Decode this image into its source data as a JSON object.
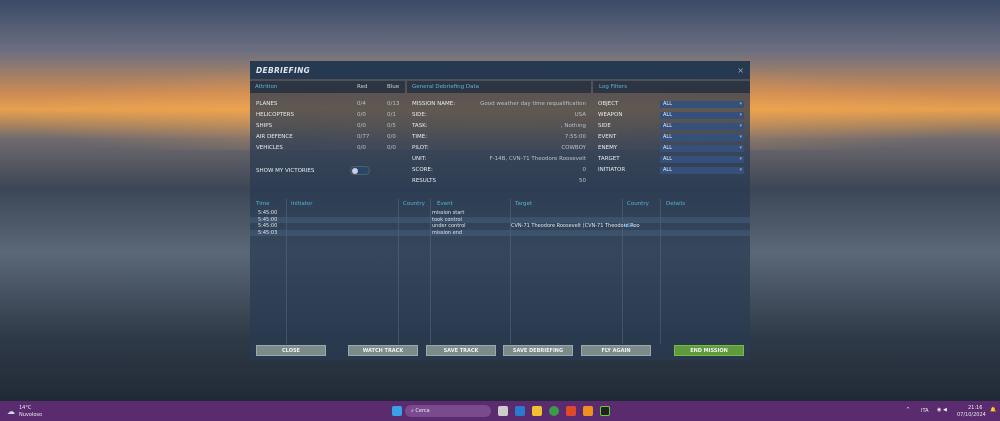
{
  "dialog": {
    "title": "DEBRIEFING",
    "close": "×"
  },
  "attrition": {
    "header": "Attrition",
    "col_red": "Red",
    "col_blue": "Blue",
    "rows": [
      {
        "label": "PLANES",
        "red": "0/4",
        "blue": "0/13"
      },
      {
        "label": "HELICOPTERS",
        "red": "0/0",
        "blue": "0/1"
      },
      {
        "label": "SHIPS",
        "red": "0/0",
        "blue": "0/5"
      },
      {
        "label": "AIR DEFENCE",
        "red": "0/77",
        "blue": "0/0"
      },
      {
        "label": "VEHICLES",
        "red": "0/0",
        "blue": "0/0"
      }
    ],
    "show_victories": "SHOW MY VICTORIES",
    "show_victories_on": false
  },
  "general": {
    "header": "General Debriefing Data",
    "rows": [
      {
        "label": "MISSION NAME:",
        "value": "Good weather day time requalification"
      },
      {
        "label": "SIDE:",
        "value": "USA"
      },
      {
        "label": "TASK:",
        "value": ", Nothing"
      },
      {
        "label": "TIME:",
        "value": "7:55:00"
      },
      {
        "label": "PILOT:",
        "value": "COWBOY"
      },
      {
        "label": "UNIT:",
        "value": "F-14B, CVN-71 Theodore Roosevelt"
      },
      {
        "label": "SCORE:",
        "value": "0"
      },
      {
        "label": "RESULTS",
        "value": "50"
      }
    ]
  },
  "filters": {
    "header": "Log Filters",
    "rows": [
      {
        "label": "OBJECT",
        "value": "ALL"
      },
      {
        "label": "WEAPON",
        "value": "ALL"
      },
      {
        "label": "SIDE",
        "value": "ALL"
      },
      {
        "label": "EVENT",
        "value": "ALL"
      },
      {
        "label": "ENEMY",
        "value": "ALL"
      },
      {
        "label": "TARGET",
        "value": "ALL"
      },
      {
        "label": "INITIATOR",
        "value": "ALL"
      }
    ]
  },
  "log": {
    "columns": [
      "Time",
      "Initiator",
      "Country",
      "Event",
      "Target",
      "Country",
      "Details"
    ],
    "rows": [
      {
        "time": "5:45:00",
        "event": "mission start",
        "target": "",
        "country": ""
      },
      {
        "time": "5:45:00",
        "event": "took control",
        "target": "",
        "country": ""
      },
      {
        "time": "5:45:00",
        "event": "under control",
        "target": "CVN-71 Theodore Roosevelt (CVN-71 Theodore Roo",
        "country": "USA"
      },
      {
        "time": "5:45:03",
        "event": "mission end",
        "target": "",
        "country": ""
      }
    ]
  },
  "buttons": {
    "close": "CLOSE",
    "watch": "WATCH TRACK",
    "save_track": "SAVE TRACK",
    "save_debrief": "SAVE DEBRIEFING",
    "fly_again": "FLY AGAIN",
    "end_mission": "END MISSION"
  },
  "taskbar": {
    "temp": "14°C",
    "weather": "Nuvoloso",
    "search": "Cerca",
    "lang": "ITA",
    "time": "21:16",
    "date": "07/10/2024"
  }
}
